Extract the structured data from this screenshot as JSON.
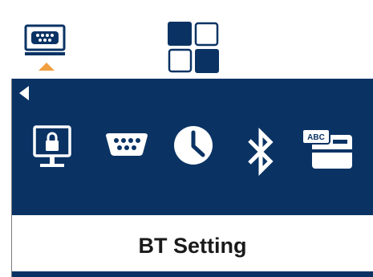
{
  "top_bar": {
    "left_icon": "serial-port-icon",
    "center_icon": "grid-menu-icon",
    "indicator_color": "#f0a040"
  },
  "menu": {
    "items": [
      {
        "icon": "secure-display-icon"
      },
      {
        "icon": "serial-port-icon"
      },
      {
        "icon": "clock-icon"
      },
      {
        "icon": "bluetooth-icon"
      },
      {
        "icon": "abc-card-icon",
        "label": "ABC"
      }
    ],
    "band_color": "#0a3364"
  },
  "title": "BT Setting"
}
